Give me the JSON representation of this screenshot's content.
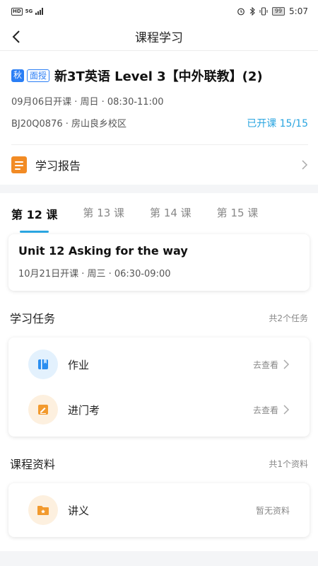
{
  "status_bar": {
    "network": "HD",
    "signal": "5G",
    "battery": "99",
    "time": "5:07"
  },
  "nav": {
    "title": "课程学习"
  },
  "course": {
    "tag_season": "秋",
    "tag_mode": "面授",
    "title": "新3T英语 Level 3【中外联教】(2)",
    "schedule": "09月06日开课 · 周日 · 08:30-11:00",
    "location": "BJ20Q0876 · 房山良乡校区",
    "progress": "已开课 15/15"
  },
  "report": {
    "label": "学习报告"
  },
  "tabs": [
    {
      "label": "第 12 课"
    },
    {
      "label": "第 13 课"
    },
    {
      "label": "第 14 课"
    },
    {
      "label": "第 15 课"
    }
  ],
  "lesson": {
    "title": "Unit 12 Asking for the way",
    "schedule": "10月21日开课 · 周三 · 06:30-09:00"
  },
  "tasks": {
    "title": "学习任务",
    "count": "共2个任务",
    "items": [
      {
        "label": "作业",
        "action": "去查看",
        "icon": "book-icon"
      },
      {
        "label": "进门考",
        "action": "去查看",
        "icon": "pencil-icon"
      }
    ]
  },
  "materials": {
    "title": "课程资料",
    "count": "共1个资料",
    "items": [
      {
        "label": "讲义",
        "action": "暂无资料",
        "icon": "folder-icon"
      }
    ]
  },
  "colors": {
    "accent": "#2aa5e0",
    "tag_blue": "#2a7ef5",
    "orange": "#f28b24"
  }
}
